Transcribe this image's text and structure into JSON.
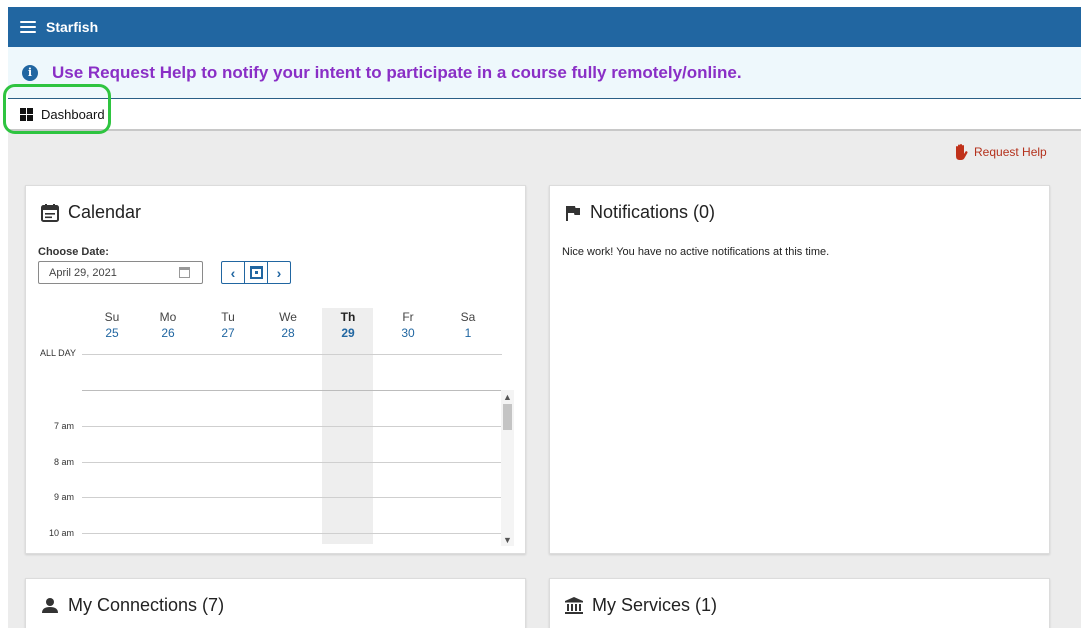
{
  "app": {
    "title": "Starfish"
  },
  "banner": {
    "text": "Use Request Help to notify your intent to participate in a course fully remotely/online."
  },
  "nav": {
    "dashboard_label": "Dashboard"
  },
  "request_help": {
    "label": "Request Help"
  },
  "calendar": {
    "title": "Calendar",
    "choose_date_label": "Choose Date:",
    "date_value": "April 29, 2021",
    "days": [
      {
        "name": "Su",
        "num": "25"
      },
      {
        "name": "Mo",
        "num": "26"
      },
      {
        "name": "Tu",
        "num": "27"
      },
      {
        "name": "We",
        "num": "28"
      },
      {
        "name": "Th",
        "num": "29"
      },
      {
        "name": "Fr",
        "num": "30"
      },
      {
        "name": "Sa",
        "num": "1"
      }
    ],
    "active_day": "Th",
    "all_day_label": "ALL DAY",
    "times": [
      "7 am",
      "8 am",
      "9 am",
      "10 am"
    ]
  },
  "notifications": {
    "title": "Notifications (0)",
    "message": "Nice work! You have no active notifications at this time."
  },
  "connections": {
    "title": "My Connections (7)"
  },
  "services": {
    "title": "My Services (1)"
  },
  "colors": {
    "header": "#2166a1",
    "banner_text": "#8a2fc6",
    "request_help": "#b4311c",
    "highlight": "#2ec440"
  }
}
